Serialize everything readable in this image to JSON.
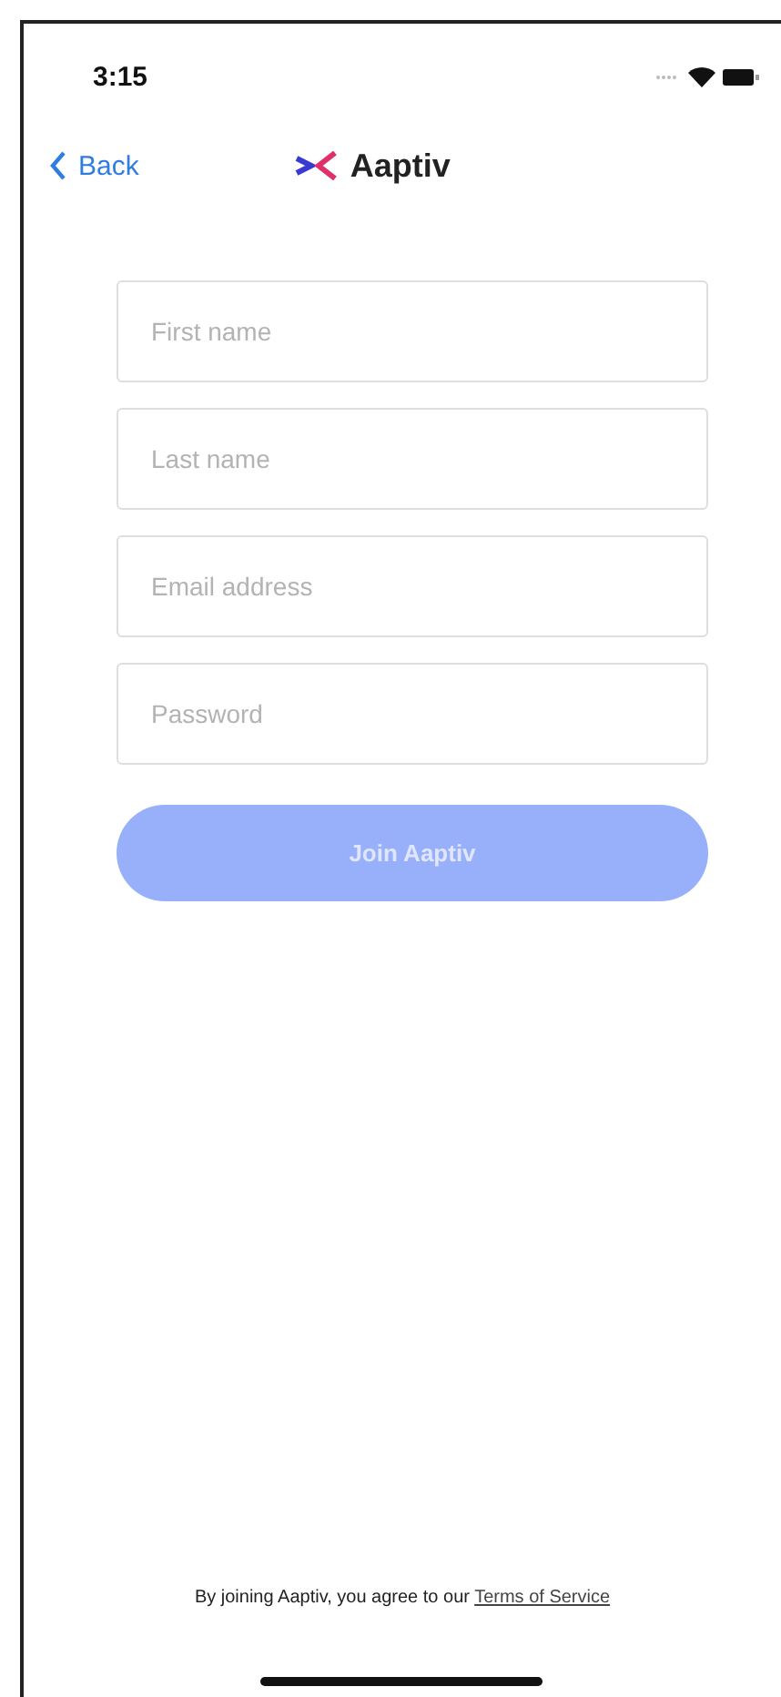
{
  "status_bar": {
    "time": "3:15"
  },
  "nav": {
    "back": "Back",
    "brand": "Aaptiv"
  },
  "fields": [
    {
      "placeholder": "First name"
    },
    {
      "placeholder": "Last name"
    },
    {
      "placeholder": "Email address"
    },
    {
      "placeholder": "Password"
    }
  ],
  "submit": {
    "label": "Join Aaptiv",
    "disabled": true
  },
  "footer": {
    "text": "By joining Aaptiv, you agree to our",
    "link": "Terms of Service"
  }
}
